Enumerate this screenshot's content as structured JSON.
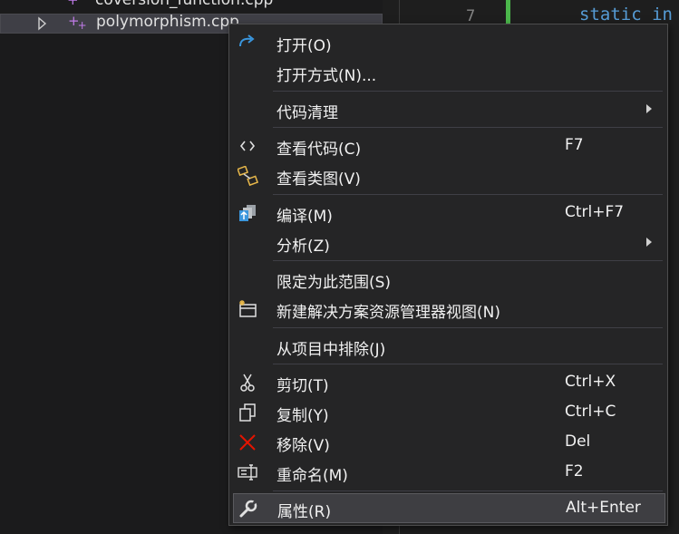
{
  "explorer": {
    "items": [
      {
        "name": "coversion_function.cpp"
      },
      {
        "name": "polymorphism.cpp"
      }
    ]
  },
  "editor": {
    "line_number": "7",
    "code_keyword": "static in"
  },
  "context_menu": {
    "items": [
      {
        "label": "打开(O)",
        "icon": "open-icon"
      },
      {
        "label": "打开方式(N)...",
        "icon": ""
      },
      {
        "label": "代码清理",
        "icon": "",
        "submenu": true
      },
      {
        "label": "查看代码(C)",
        "shortcut": "F7",
        "icon": "view-code-icon"
      },
      {
        "label": "查看类图(V)",
        "icon": "class-diagram-icon"
      },
      {
        "label": "编译(M)",
        "shortcut": "Ctrl+F7",
        "icon": "compile-icon"
      },
      {
        "label": "分析(Z)",
        "icon": "",
        "submenu": true
      },
      {
        "label": "限定为此范围(S)",
        "icon": ""
      },
      {
        "label": "新建解决方案资源管理器视图(N)",
        "icon": "new-view-icon"
      },
      {
        "label": "从项目中排除(J)",
        "icon": ""
      },
      {
        "label": "剪切(T)",
        "shortcut": "Ctrl+X",
        "icon": "cut-icon"
      },
      {
        "label": "复制(Y)",
        "shortcut": "Ctrl+C",
        "icon": "copy-icon"
      },
      {
        "label": "移除(V)",
        "shortcut": "Del",
        "icon": "remove-icon"
      },
      {
        "label": "重命名(M)",
        "shortcut": "F2",
        "icon": "rename-icon"
      },
      {
        "label": "属性(R)",
        "shortcut": "Alt+Enter",
        "icon": "properties-icon",
        "highlighted": true
      }
    ]
  },
  "colors": {
    "menu_bg": "#252526",
    "highlight_bg": "#3e3e42",
    "cpp_icon": "#c07be8",
    "keyword": "#569cd6",
    "git_change": "#4bb74b",
    "remove_icon": "#e51400"
  }
}
